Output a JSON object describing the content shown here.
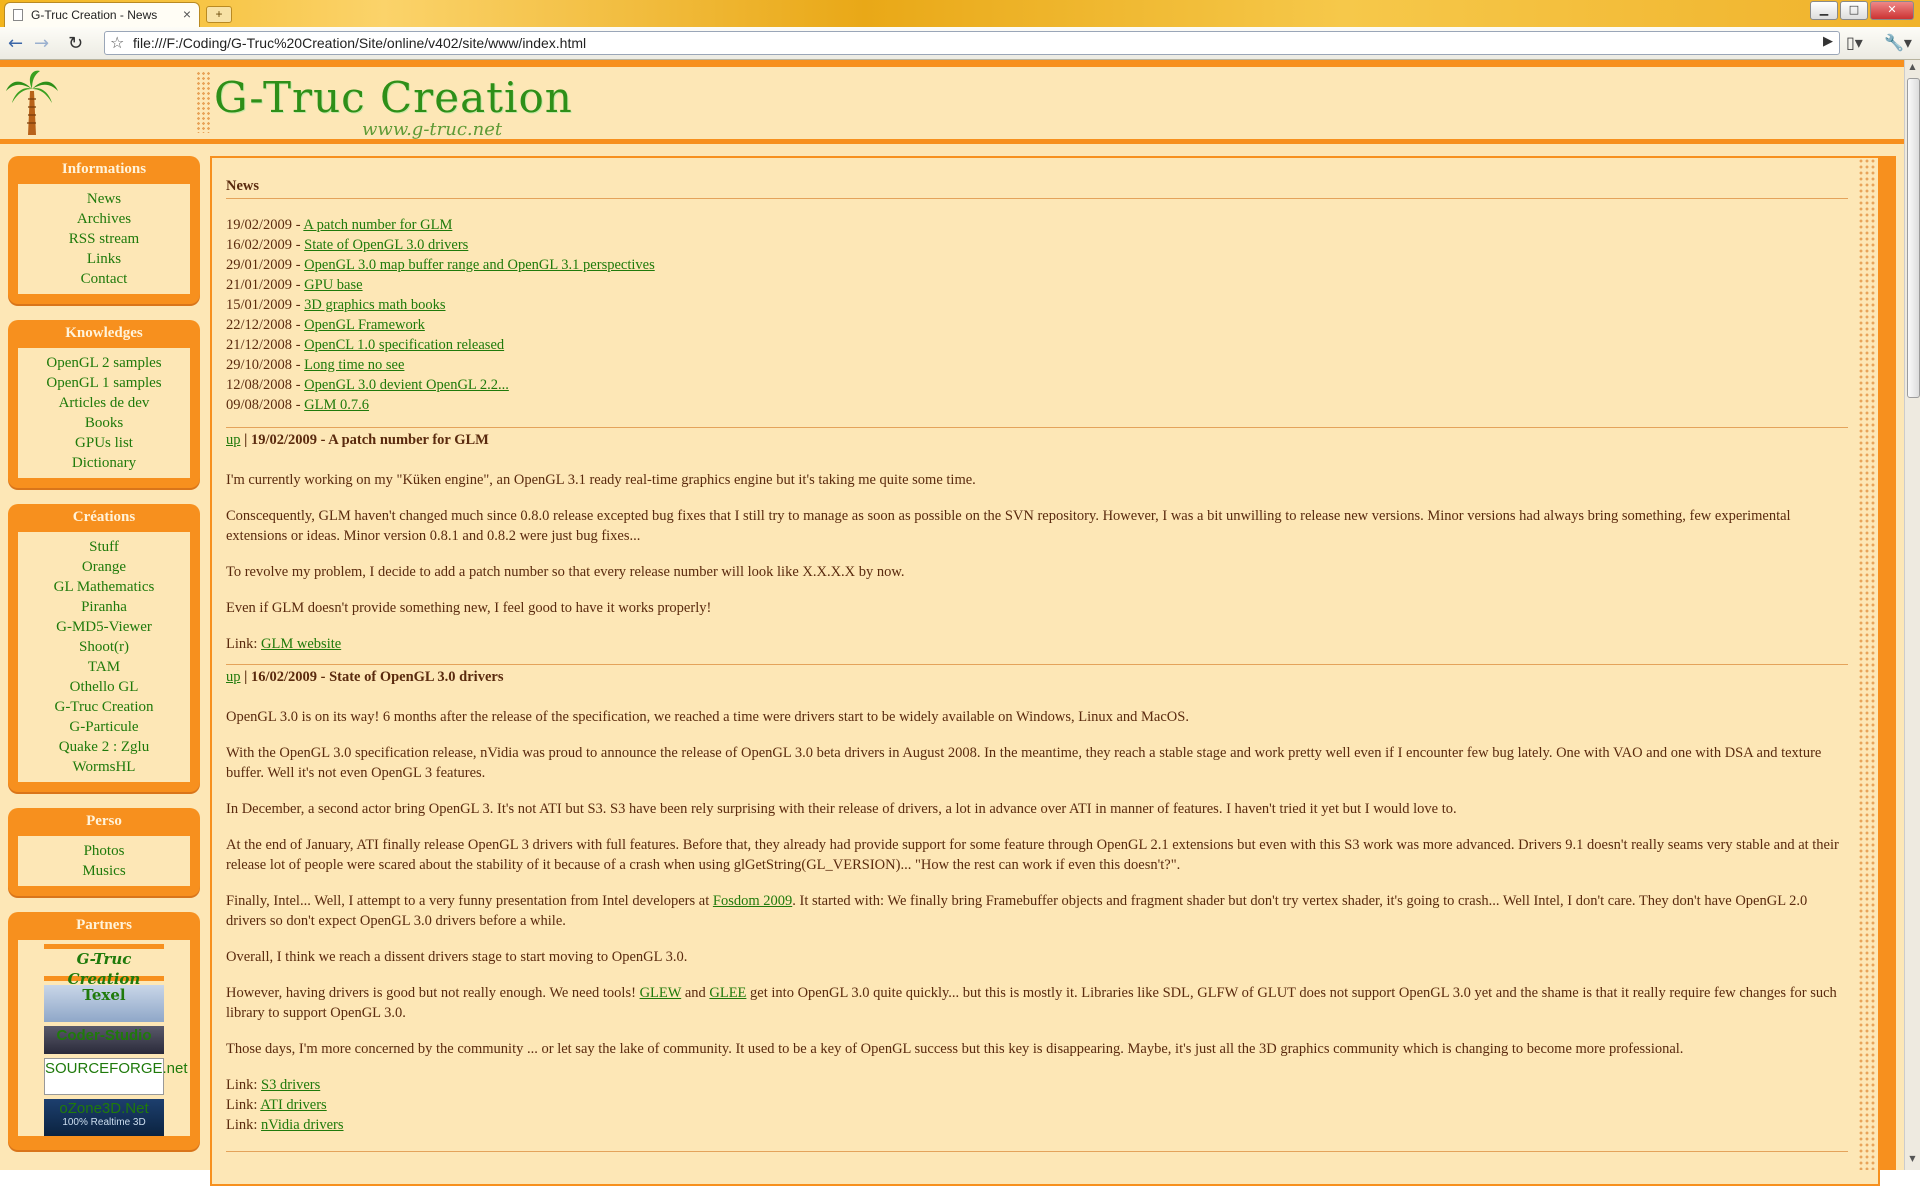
{
  "browser": {
    "tab_title": "G-Truc Creation - News",
    "tab_close": "×",
    "new_tab": "+",
    "url": "file:///F:/Coding/G-Truc%20Creation/Site/online/v402/site/www/index.html",
    "win_min": "▁",
    "win_max": "□",
    "win_close": "✕",
    "back": "←",
    "forward": "→",
    "reload": "↻",
    "star": "☆",
    "go": "▶",
    "page_menu": "▯▾",
    "tools_menu": "🔧▾"
  },
  "header": {
    "logo": "G-Truc Creation",
    "logo_sub": "www.g-truc.net"
  },
  "sidebar": {
    "informations": {
      "title": "Informations",
      "items": [
        "News",
        "Archives",
        "RSS stream",
        "Links",
        "Contact"
      ]
    },
    "knowledges": {
      "title": "Knowledges",
      "items": [
        "OpenGL 2 samples",
        "OpenGL 1 samples",
        "Articles de dev",
        "Books",
        "GPUs list",
        "Dictionary"
      ]
    },
    "creations": {
      "title": "Créations",
      "items": [
        "Stuff",
        "Orange",
        "GL Mathematics",
        "Piranha",
        "G-MD5-Viewer",
        "Shoot(r)",
        "TAM",
        "Othello GL",
        "G-Truc Creation",
        "G-Particule",
        "Quake 2 : Zglu",
        "WormsHL"
      ]
    },
    "perso": {
      "title": "Perso",
      "items": [
        "Photos",
        "Musics"
      ]
    },
    "partners": {
      "title": "Partners",
      "gtruc": "G-Truc Creation",
      "texel": "Texel",
      "coder": "Coder-Studio",
      "sf": "SOURCEFORGE.net",
      "ozone": "oZone3D.Net",
      "ozone_sub": "100% Realtime 3D"
    }
  },
  "content": {
    "heading": "News",
    "news": [
      {
        "date": "19/02/2009",
        "sep": " - ",
        "title": "A patch number for GLM"
      },
      {
        "date": "16/02/2009",
        "sep": " - ",
        "title": "State of OpenGL 3.0 drivers"
      },
      {
        "date": "29/01/2009",
        "sep": " - ",
        "title": "OpenGL 3.0 map buffer range and OpenGL 3.1 perspectives"
      },
      {
        "date": "21/01/2009",
        "sep": " - ",
        "title": "GPU base"
      },
      {
        "date": "15/01/2009",
        "sep": " - ",
        "title": "3D graphics math books"
      },
      {
        "date": "22/12/2008",
        "sep": " - ",
        "title": "OpenGL Framework"
      },
      {
        "date": "21/12/2008",
        "sep": " - ",
        "title": "OpenCL 1.0 specification released"
      },
      {
        "date": "29/10/2008",
        "sep": " - ",
        "title": "Long time no see"
      },
      {
        "date": "12/08/2008",
        "sep": " - ",
        "title": "OpenGL 3.0 devient OpenGL 2.2..."
      },
      {
        "date": "09/08/2008",
        "sep": " - ",
        "title": "GLM 0.7.6"
      }
    ],
    "up": "up",
    "post1": {
      "title": " | 19/02/2009 - A patch number for GLM",
      "p1": "I'm currently working on my \"Küken engine\", an OpenGL 3.1 ready real-time graphics engine but it's taking me quite some time.",
      "p2": "Conscequently, GLM haven't changed much since 0.8.0 release excepted bug fixes that I still try to manage as soon as possible on the SVN repository. However, I was a bit unwilling to release new versions. Minor versions had always bring something, few experimental extensions or ideas. Minor version 0.8.1 and 0.8.2 were just bug fixes...",
      "p3": "To revolve my problem, I decide to add a patch number so that every release number will look like X.X.X.X by now.",
      "p4": "Even if GLM doesn't provide something new, I feel good to have it works properly!",
      "link_label": "Link: ",
      "link_text": "GLM website"
    },
    "post2": {
      "title": " | 16/02/2009 - State of OpenGL 3.0 drivers",
      "p1": "OpenGL 3.0 is on its way! 6 months after the release of the specification, we reached a time were drivers start to be widely available on Windows, Linux and MacOS.",
      "p2": "With the OpenGL 3.0 specification release, nVidia was proud to announce the release of OpenGL 3.0 beta drivers in August 2008. In the meantime, they reach a stable stage and work pretty well even if I encounter few bug lately. One with VAO and one with DSA and texture buffer. Well it's not even OpenGL 3 features.",
      "p3": "In December, a second actor bring OpenGL 3. It's not ATI but S3. S3 have been rely surprising with their release of drivers, a lot in advance over ATI in manner of features. I haven't tried it yet but I would love to.",
      "p4": "At the end of January, ATI finally release OpenGL 3 drivers with full features. Before that, they already had provide support for some feature through OpenGL 2.1 extensions but even with this S3 work was more advanced. Drivers 9.1 doesn't really seams very stable and at their release lot of people were scared about the stability of it because of a crash when using glGetString(GL_VERSION)... \"How the rest can work if even this doesn't?\".",
      "p5a": "Finally, Intel... Well, I attempt to a very funny presentation from Intel developers at ",
      "p5link": "Fosdom 2009",
      "p5b": ". It started with: We finally bring Framebuffer objects and fragment shader but don't try vertex shader, it's going to crash... Well Intel, I don't care. They don't have OpenGL 2.0 drivers so don't expect OpenGL 3.0 drivers before a while.",
      "p6": "Overall, I think we reach a dissent drivers stage to start moving to OpenGL 3.0.",
      "p7a": "However, having drivers is good but not really enough. We need tools! ",
      "p7link1": "GLEW",
      "p7mid": " and ",
      "p7link2": "GLEE",
      "p7b": " get into OpenGL 3.0 quite quickly... but this is mostly it. Libraries like SDL, GLFW of GLUT does not support OpenGL 3.0 yet and the shame is that it really require few changes for such library to support OpenGL 3.0.",
      "p8": "Those days, I'm more concerned by the community ... or let say the lake of community. It used to be a key of OpenGL success but this key is disappearing. Maybe, it's just all the 3D graphics community which is changing to become more professional.",
      "link_label": "Link: ",
      "links": [
        "S3 drivers",
        "ATI drivers",
        "nVidia drivers"
      ]
    }
  },
  "colors": {
    "accent": "#f7901e",
    "background": "#fde7b6",
    "link": "#1f7a0b",
    "text": "#5a2a0e"
  }
}
